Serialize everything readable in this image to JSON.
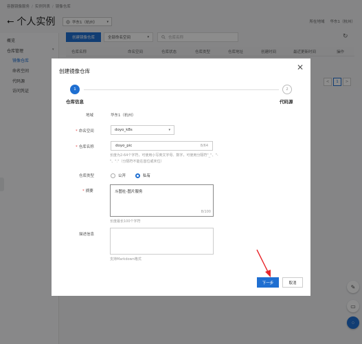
{
  "breadcrumb": [
    "容器镜像服务",
    "实例列表",
    "镜像仓库"
  ],
  "page": {
    "title": "个人实例",
    "region_label": "华东1（杭州）"
  },
  "topbar": {
    "region_text": "所在地域",
    "region_value": "华东1（杭州）"
  },
  "sidebar": {
    "items": [
      {
        "label": "概览"
      },
      {
        "label": "仓库管理"
      },
      {
        "label": "镜像仓库"
      },
      {
        "label": "命名空间"
      },
      {
        "label": "代码源"
      },
      {
        "label": "访问凭证"
      }
    ]
  },
  "toolbar": {
    "create_label": "创建镜像仓库",
    "namespace_select": "全部命名空间",
    "search_placeholder": "仓库名称"
  },
  "table": {
    "columns": [
      "仓库名称",
      "命名空间",
      "仓库状态",
      "仓库类型",
      "仓库地址",
      "创建时间",
      "最近更新时间",
      "操作"
    ]
  },
  "pager": {
    "prev": "<",
    "current": "1",
    "next": ">"
  },
  "modal": {
    "title": "创建镜像仓库",
    "steps": [
      {
        "number": "1",
        "label": "仓库信息",
        "state": "active"
      },
      {
        "number": "2",
        "label": "代码源",
        "state": "pending"
      }
    ],
    "region": {
      "label": "地域",
      "value": "华东1（杭州）"
    },
    "namespace": {
      "label": "命名空间",
      "value": "doyo_k8s"
    },
    "repo_name": {
      "label": "仓库名称",
      "value": "doyo_pic",
      "counter": "8/64",
      "hint": "长度为2-64个字符，可使用小写英文字母、数字，可使用分隔符\"_\"、\"-\"、\".\"（分隔符不能在首位或末位）"
    },
    "repo_type": {
      "label": "仓库类型",
      "options": [
        "公开",
        "私有"
      ],
      "selected": "私有"
    },
    "summary": {
      "label": "摘要",
      "value": "斗图社-图片服务",
      "counter": "8/100",
      "hint": "长度最长100个字符"
    },
    "description": {
      "label": "描述信息",
      "hint": "支持Markdown格式"
    },
    "next_label": "下一步",
    "cancel_label": "取消"
  },
  "colors": {
    "primary": "#1f6fd1",
    "annotation_arrow": "#e8262b"
  },
  "icons": {
    "back": "back-arrow-icon",
    "close": "close-icon",
    "search": "search-icon",
    "refresh": "refresh-icon",
    "edit": "edit-icon",
    "message": "message-icon",
    "apps": "apps-icon"
  }
}
